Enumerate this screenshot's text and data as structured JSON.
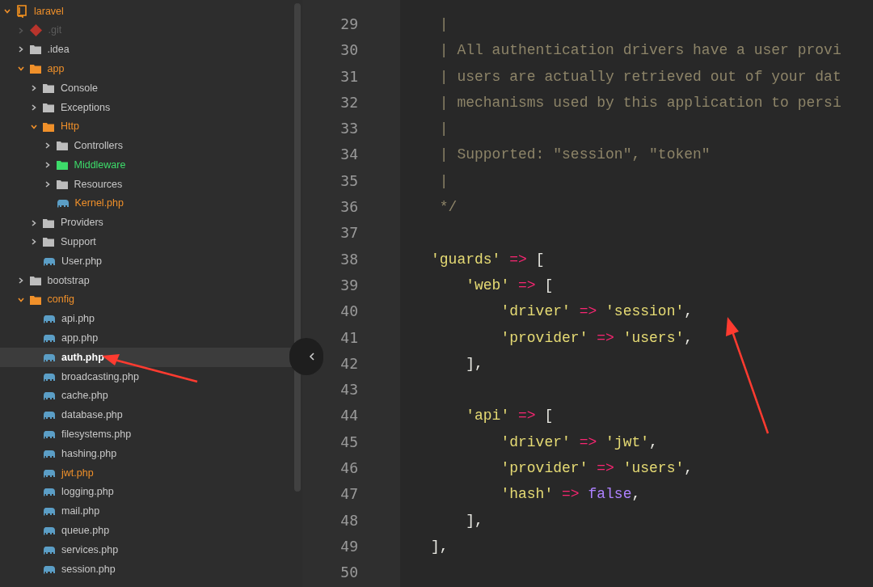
{
  "tree": [
    {
      "kind": "project",
      "label": "laravel",
      "color": "#f0902a",
      "expanded": true,
      "selected": false,
      "children": [
        {
          "kind": "git",
          "label": ".git",
          "color": "#5c5c5c",
          "expanded": false,
          "selected": false
        },
        {
          "kind": "folder",
          "label": ".idea",
          "color": "#c8c8c8",
          "expanded": false,
          "selected": false
        },
        {
          "kind": "folder",
          "label": "app",
          "color": "#f0902a",
          "expanded": true,
          "selected": false,
          "children": [
            {
              "kind": "folder",
              "label": "Console",
              "color": "#c8c8c8",
              "expanded": false,
              "selected": false
            },
            {
              "kind": "folder",
              "label": "Exceptions",
              "color": "#c8c8c8",
              "expanded": false,
              "selected": false
            },
            {
              "kind": "folder",
              "label": "Http",
              "color": "#f0902a",
              "expanded": true,
              "selected": false,
              "children": [
                {
                  "kind": "folder",
                  "label": "Controllers",
                  "color": "#c8c8c8",
                  "expanded": false,
                  "selected": false
                },
                {
                  "kind": "folder",
                  "label": "Middleware",
                  "color": "#3ddc6a",
                  "expanded": false,
                  "selected": false
                },
                {
                  "kind": "folder",
                  "label": "Resources",
                  "color": "#c8c8c8",
                  "expanded": false,
                  "selected": false
                },
                {
                  "kind": "file",
                  "label": "Kernel.php",
                  "color": "#f0902a",
                  "selected": false
                }
              ]
            },
            {
              "kind": "folder",
              "label": "Providers",
              "color": "#c8c8c8",
              "expanded": false,
              "selected": false
            },
            {
              "kind": "folder",
              "label": "Support",
              "color": "#c8c8c8",
              "expanded": false,
              "selected": false
            },
            {
              "kind": "file",
              "label": "User.php",
              "color": "#c8c8c8",
              "selected": false
            }
          ]
        },
        {
          "kind": "folder",
          "label": "bootstrap",
          "color": "#c8c8c8",
          "expanded": false,
          "selected": false
        },
        {
          "kind": "folder",
          "label": "config",
          "color": "#f0902a",
          "expanded": true,
          "selected": false,
          "children": [
            {
              "kind": "file",
              "label": "api.php",
              "color": "#c8c8c8",
              "selected": false
            },
            {
              "kind": "file",
              "label": "app.php",
              "color": "#c8c8c8",
              "selected": false
            },
            {
              "kind": "file",
              "label": "auth.php",
              "color": "#ffffff",
              "selected": true
            },
            {
              "kind": "file",
              "label": "broadcasting.php",
              "color": "#c8c8c8",
              "selected": false
            },
            {
              "kind": "file",
              "label": "cache.php",
              "color": "#c8c8c8",
              "selected": false
            },
            {
              "kind": "file",
              "label": "database.php",
              "color": "#c8c8c8",
              "selected": false
            },
            {
              "kind": "file",
              "label": "filesystems.php",
              "color": "#c8c8c8",
              "selected": false
            },
            {
              "kind": "file",
              "label": "hashing.php",
              "color": "#c8c8c8",
              "selected": false
            },
            {
              "kind": "file",
              "label": "jwt.php",
              "color": "#f0902a",
              "selected": false
            },
            {
              "kind": "file",
              "label": "logging.php",
              "color": "#c8c8c8",
              "selected": false
            },
            {
              "kind": "file",
              "label": "mail.php",
              "color": "#c8c8c8",
              "selected": false
            },
            {
              "kind": "file",
              "label": "queue.php",
              "color": "#c8c8c8",
              "selected": false
            },
            {
              "kind": "file",
              "label": "services.php",
              "color": "#c8c8c8",
              "selected": false
            },
            {
              "kind": "file",
              "label": "session.php",
              "color": "#c8c8c8",
              "selected": false
            }
          ]
        }
      ]
    }
  ],
  "editor": {
    "lines": [
      {
        "number": "29",
        "tokens": [
          {
            "kind": "comment",
            "text": " |"
          }
        ]
      },
      {
        "number": "30",
        "tokens": [
          {
            "kind": "comment",
            "text": " | All authentication drivers have a user provi"
          }
        ]
      },
      {
        "number": "31",
        "tokens": [
          {
            "kind": "comment",
            "text": " | users are actually retrieved out of your dat"
          }
        ]
      },
      {
        "number": "32",
        "tokens": [
          {
            "kind": "comment",
            "text": " | mechanisms used by this application to persi"
          }
        ]
      },
      {
        "number": "33",
        "tokens": [
          {
            "kind": "comment",
            "text": " |"
          }
        ]
      },
      {
        "number": "34",
        "tokens": [
          {
            "kind": "comment",
            "text": " | Supported: \"session\", \"token\""
          }
        ]
      },
      {
        "number": "35",
        "tokens": [
          {
            "kind": "comment",
            "text": " |"
          }
        ]
      },
      {
        "number": "36",
        "tokens": [
          {
            "kind": "comment",
            "text": " */"
          }
        ]
      },
      {
        "number": "37"
      },
      {
        "number": "38",
        "tokens": [
          {
            "kind": "string",
            "text": "'guards'"
          },
          {
            "kind": "operator",
            "text": " => "
          },
          {
            "kind": "punct",
            "text": "["
          }
        ]
      },
      {
        "number": "39",
        "tokens": [
          {
            "kind": "string",
            "text": "    'web'"
          },
          {
            "kind": "operator",
            "text": " => "
          },
          {
            "kind": "punct",
            "text": "["
          }
        ]
      },
      {
        "number": "40",
        "tokens": [
          {
            "kind": "string",
            "text": "        'driver'"
          },
          {
            "kind": "operator",
            "text": " => "
          },
          {
            "kind": "string",
            "text": "'session'"
          },
          {
            "kind": "punct",
            "text": ","
          }
        ]
      },
      {
        "number": "41",
        "tokens": [
          {
            "kind": "string",
            "text": "        'provider'"
          },
          {
            "kind": "operator",
            "text": " => "
          },
          {
            "kind": "string",
            "text": "'users'"
          },
          {
            "kind": "punct",
            "text": ","
          }
        ]
      },
      {
        "number": "42",
        "tokens": [
          {
            "kind": "punct",
            "text": "    ],"
          }
        ]
      },
      {
        "number": "43"
      },
      {
        "number": "44",
        "tokens": [
          {
            "kind": "string",
            "text": "    'api'"
          },
          {
            "kind": "operator",
            "text": " => "
          },
          {
            "kind": "punct",
            "text": "["
          }
        ]
      },
      {
        "number": "45",
        "tokens": [
          {
            "kind": "string",
            "text": "        'driver'"
          },
          {
            "kind": "operator",
            "text": " => "
          },
          {
            "kind": "string",
            "text": "'jwt'"
          },
          {
            "kind": "punct",
            "text": ","
          }
        ]
      },
      {
        "number": "46",
        "tokens": [
          {
            "kind": "string",
            "text": "        'provider'"
          },
          {
            "kind": "operator",
            "text": " => "
          },
          {
            "kind": "string",
            "text": "'users'"
          },
          {
            "kind": "punct",
            "text": ","
          }
        ]
      },
      {
        "number": "47",
        "tokens": [
          {
            "kind": "string",
            "text": "        'hash'"
          },
          {
            "kind": "operator",
            "text": " => "
          },
          {
            "kind": "constant",
            "text": "false"
          },
          {
            "kind": "punct",
            "text": ","
          }
        ]
      },
      {
        "number": "48",
        "tokens": [
          {
            "kind": "punct",
            "text": "    ],"
          }
        ]
      },
      {
        "number": "49",
        "tokens": [
          {
            "kind": "punct",
            "text": "],"
          }
        ]
      },
      {
        "number": "50"
      }
    ]
  }
}
